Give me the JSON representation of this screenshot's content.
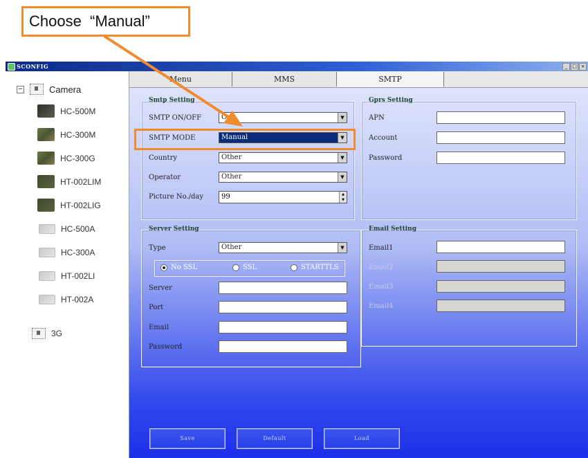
{
  "annotation": {
    "text": "Choose  “Manual”",
    "color": "#f28a2e"
  },
  "window": {
    "title": "SCONFIG",
    "controls": {
      "minimize": "_",
      "maximize": "□",
      "close": "×"
    }
  },
  "tree": {
    "root": {
      "expander": "−",
      "label": "Camera"
    },
    "items": [
      {
        "label": "HC-500M",
        "thumb": "dark"
      },
      {
        "label": "HC-300M",
        "thumb": "camo"
      },
      {
        "label": "HC-300G",
        "thumb": "camo"
      },
      {
        "label": "HT-002LIM",
        "thumb": "green"
      },
      {
        "label": "HT-002LIG",
        "thumb": "green"
      },
      {
        "label": "HC-500A",
        "thumb": "grey"
      },
      {
        "label": "HC-300A",
        "thumb": "grey"
      },
      {
        "label": "HT-002LI",
        "thumb": "grey"
      },
      {
        "label": "HT-002A",
        "thumb": "grey"
      }
    ],
    "extra": {
      "label": "3G"
    }
  },
  "tabs": [
    {
      "label": "Menu",
      "active": false
    },
    {
      "label": "MMS",
      "active": false
    },
    {
      "label": "SMTP",
      "active": true
    }
  ],
  "smtp_setting": {
    "title": "Smtp Setting",
    "onoff": {
      "label": "SMTP ON/OFF",
      "value": "On"
    },
    "mode": {
      "label": "SMTP MODE",
      "value": "Manual"
    },
    "country": {
      "label": "Country",
      "value": "Other"
    },
    "operator": {
      "label": "Operator",
      "value": "Other"
    },
    "picture": {
      "label": "Picture No./day",
      "value": "99"
    }
  },
  "gprs_setting": {
    "title": "Gprs Setting",
    "apn_label": "APN",
    "account_label": "Account",
    "password_label": "Password"
  },
  "server_setting": {
    "title": "Server Setting",
    "type": {
      "label": "Type",
      "value": "Other"
    },
    "ssl_options": [
      {
        "label": "No SSL",
        "selected": true
      },
      {
        "label": "SSL",
        "selected": false
      },
      {
        "label": "STARTTLS",
        "selected": false
      }
    ],
    "server_label": "Server",
    "port_label": "Port",
    "email_label": "Email",
    "password_label": "Password"
  },
  "email_setting": {
    "title": "Email Setting",
    "email1_label": "Email1",
    "email2_label": "Email2",
    "email3_label": "Email3",
    "email4_label": "Email4"
  },
  "buttons": {
    "save": "Save",
    "default": "Default",
    "load": "Load"
  }
}
